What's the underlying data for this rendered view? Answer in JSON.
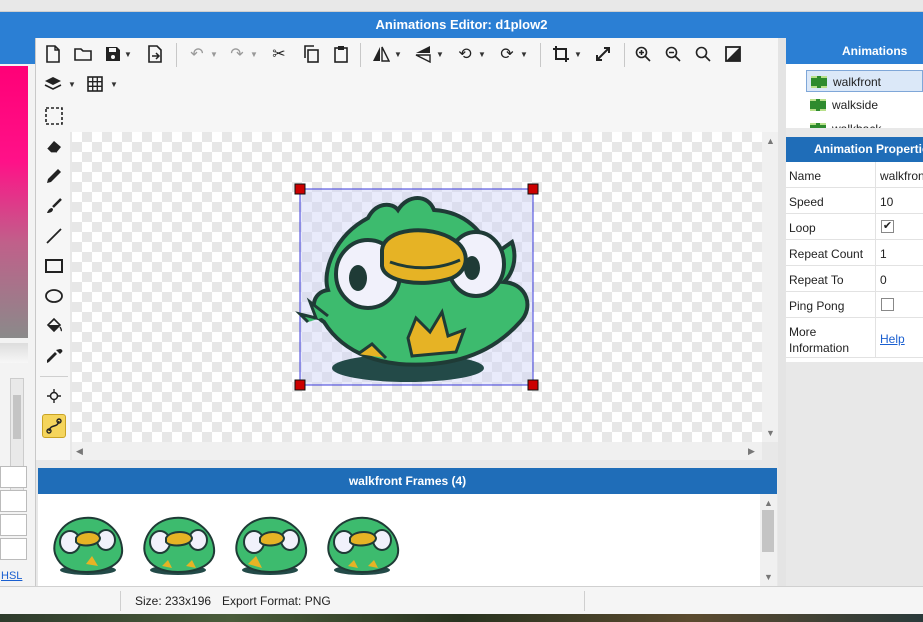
{
  "window": {
    "title": "Animations Editor: d1plow2"
  },
  "toolbar": {
    "icons": [
      "new-file-icon",
      "open-folder-icon",
      "save-icon",
      "export-icon",
      "undo-icon",
      "redo-icon",
      "cut-icon",
      "copy-icon",
      "paste-icon",
      "flip-horizontal-icon",
      "flip-vertical-icon",
      "rotate-left-icon",
      "rotate-right-icon",
      "crop-icon",
      "resize-icon",
      "zoom-in-icon",
      "zoom-out-icon",
      "zoom-reset-icon",
      "contrast-icon",
      "layers-icon",
      "grid-icon"
    ]
  },
  "left_panel": {
    "mode_link": "HSL"
  },
  "tools": [
    "selection-icon",
    "eraser-icon",
    "pencil-icon",
    "brush-icon",
    "line-icon",
    "rectangle-icon",
    "ellipse-icon",
    "fill-icon",
    "eyedropper-icon",
    "pivot-icon",
    "path-icon"
  ],
  "frames_panel": {
    "title": "walkfront Frames (4)",
    "frame_count": 4
  },
  "animations_panel": {
    "title": "Animations",
    "items": [
      {
        "label": "walkfront",
        "selected": true
      },
      {
        "label": "walkside",
        "selected": false
      },
      {
        "label": "walkback",
        "selected": false
      }
    ]
  },
  "properties_panel": {
    "title": "Animation Properties",
    "rows": [
      {
        "key": "Name",
        "value": "walkfront"
      },
      {
        "key": "Speed",
        "value": "10"
      },
      {
        "key": "Loop",
        "checked": true
      },
      {
        "key": "Repeat Count",
        "value": "1"
      },
      {
        "key": "Repeat To",
        "value": "0"
      },
      {
        "key": "Ping Pong",
        "checked": false
      },
      {
        "key": "More Information",
        "link": "Help"
      }
    ]
  },
  "status_bar": {
    "size": "Size: 233x196",
    "format": "Export Format: PNG"
  },
  "colors": {
    "title_blue": "#2b7fd4",
    "header_blue": "#1f6db8",
    "bird_green": "#3dbb6e",
    "beak_yellow": "#e6b325",
    "selection_handle": "#cc0000"
  }
}
